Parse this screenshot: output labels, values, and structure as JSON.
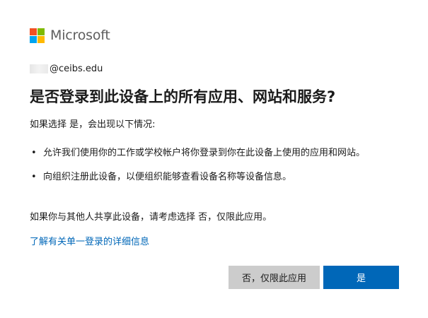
{
  "brand": {
    "name": "Microsoft",
    "squares": [
      "#f25022",
      "#7fba00",
      "#00a4ef",
      "#ffb900"
    ]
  },
  "account": {
    "email_domain": "@ceibs.edu"
  },
  "dialog": {
    "title": "是否登录到此设备上的所有应用、网站和服务?",
    "intro": "如果选择 是，会出现以下情况:",
    "bullets": [
      "允许我们使用你的工作或学校帐户将你登录到你在此设备上使用的应用和网站。",
      "向组织注册此设备，以便组织能够查看设备名称等设备信息。"
    ],
    "note": "如果你与其他人共享此设备，请考虑选择 否，仅限此应用。",
    "learn_more_link": "了解有关单一登录的详细信息"
  },
  "buttons": {
    "no_label": "否，仅限此应用",
    "yes_label": "是"
  },
  "colors": {
    "primary": "#0067b8",
    "secondary_button": "#cccccc",
    "link": "#0067b8"
  }
}
